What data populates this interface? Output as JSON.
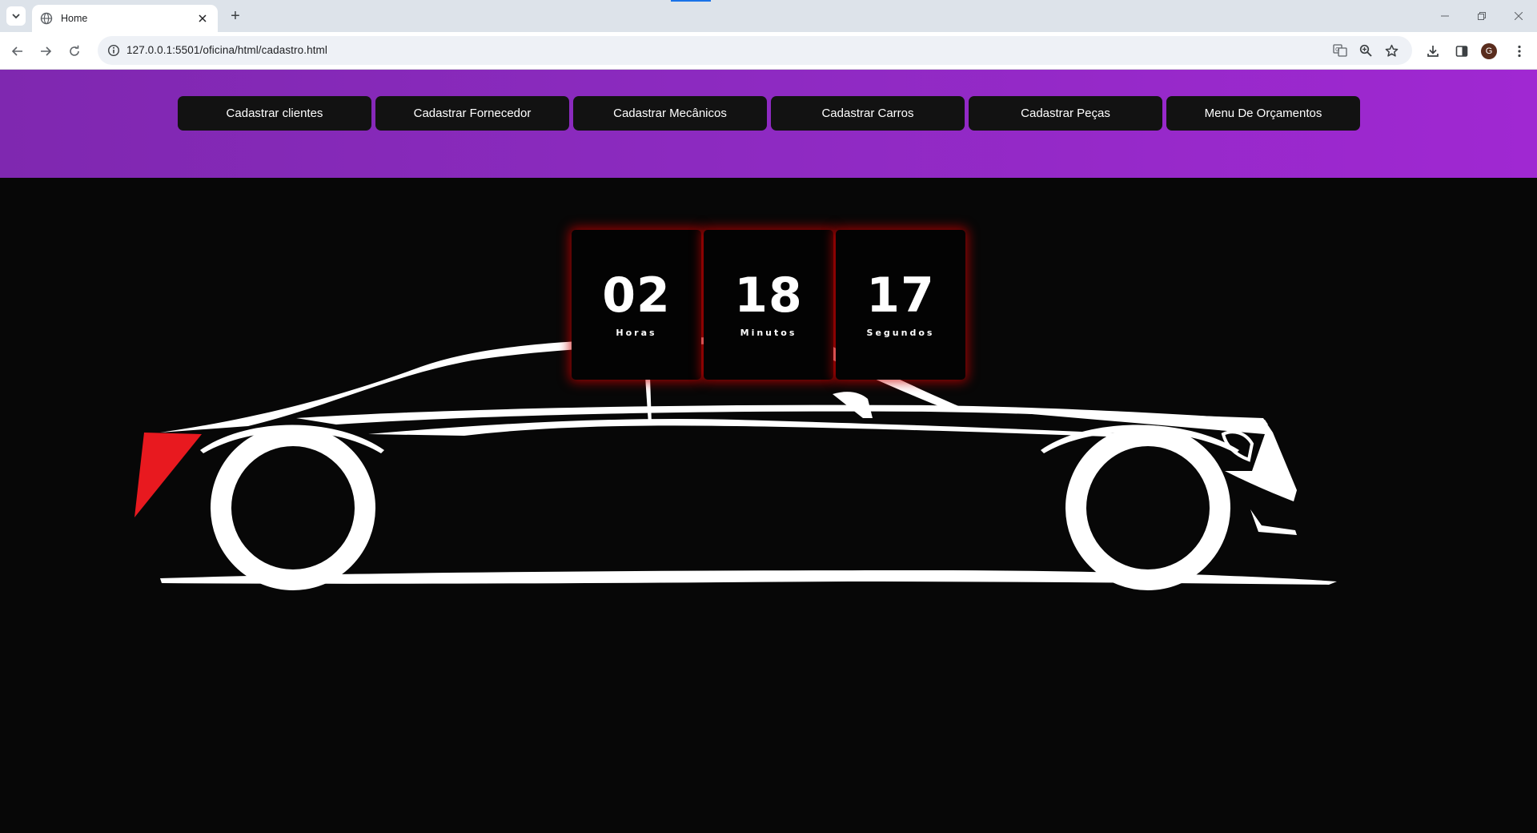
{
  "browser": {
    "tab_title": "Home",
    "new_tab_symbol": "+",
    "url": "127.0.0.1:5501/oficina/html/cadastro.html",
    "profile_initial": "G",
    "icons": [
      "tab-search-icon",
      "globe-icon",
      "close-icon",
      "back-icon",
      "forward-icon",
      "reload-icon",
      "site-info-icon",
      "translate-icon",
      "zoom-icon",
      "star-icon",
      "download-icon",
      "side-panel-icon",
      "menu-icon"
    ]
  },
  "nav": {
    "items": [
      {
        "label": "Cadastrar clientes"
      },
      {
        "label": "Cadastrar Fornecedor"
      },
      {
        "label": "Cadastrar Mecânicos"
      },
      {
        "label": "Cadastrar Carros"
      },
      {
        "label": "Cadastrar Peças"
      },
      {
        "label": "Menu De Orçamentos"
      }
    ]
  },
  "countdown": {
    "hours": {
      "value": "02",
      "label": "Horas"
    },
    "minutes": {
      "value": "18",
      "label": "Minutos"
    },
    "seconds": {
      "value": "17",
      "label": "Segundos"
    }
  },
  "colors": {
    "header_purple": "#8c2ac0",
    "button_bg": "#121212",
    "glow_red": "#c80000",
    "taillight_red": "#e8191f",
    "page_bg": "#070707"
  }
}
